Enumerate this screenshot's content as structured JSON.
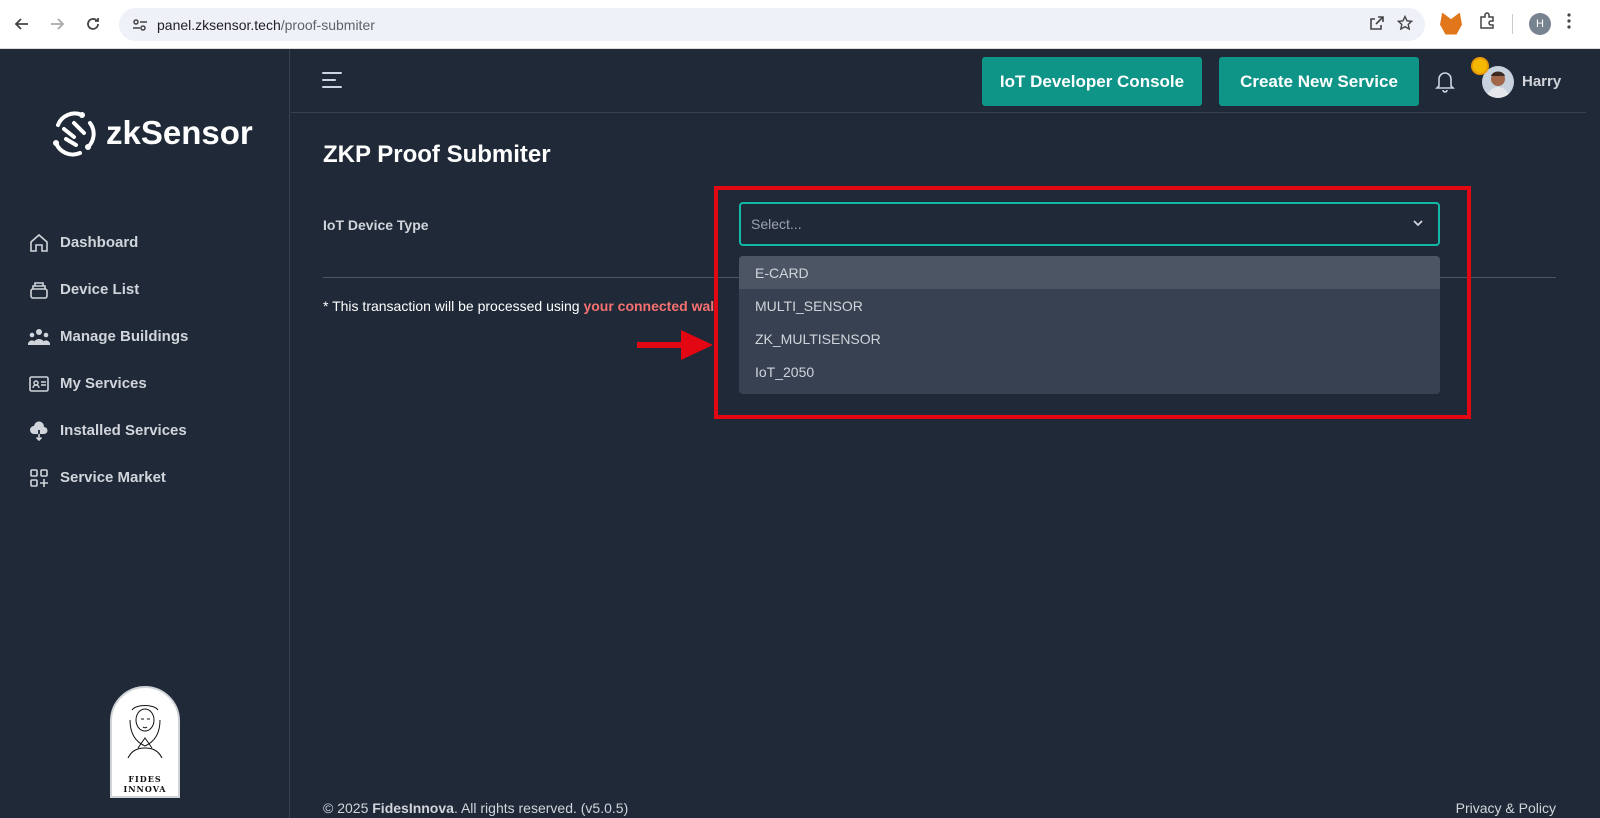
{
  "browser": {
    "url_host": "panel.zksensor.tech",
    "url_path": "/proof-submiter",
    "profile_initial": "H"
  },
  "brand": {
    "name": "zkSensor",
    "accent": "#0f9488",
    "focus_border": "#14b8a6",
    "highlight": "#f87171",
    "annotation_red": "#e30613"
  },
  "sidebar": {
    "items": [
      {
        "label": "Dashboard",
        "icon": "home-icon"
      },
      {
        "label": "Device List",
        "icon": "device-stack-icon"
      },
      {
        "label": "Manage Buildings",
        "icon": "users-icon"
      },
      {
        "label": "My Services",
        "icon": "id-card-icon"
      },
      {
        "label": "Installed Services",
        "icon": "cloud-download-icon"
      },
      {
        "label": "Service Market",
        "icon": "grid-plus-icon"
      }
    ],
    "footer_logo_text": [
      "FIDES",
      "INNOVA"
    ]
  },
  "header": {
    "console_button": "IoT Developer Console",
    "create_button": "Create New Service",
    "user_name": "Harry"
  },
  "main": {
    "title": "ZKP Proof Submiter",
    "device_type_label": "IoT Device Type",
    "select_placeholder": "Select...",
    "options": [
      "E-CARD",
      "MULTI_SENSOR",
      "ZK_MULTISENSOR",
      "IoT_2050"
    ],
    "notice_prefix": "* This transaction will be processed using ",
    "notice_highlight": "your connected wal"
  },
  "footer": {
    "copyright_prefix": "© 2025 ",
    "company": "FidesInnova",
    "copyright_suffix": ". All rights reserved. (v5.0.5)",
    "privacy": "Privacy & Policy"
  }
}
